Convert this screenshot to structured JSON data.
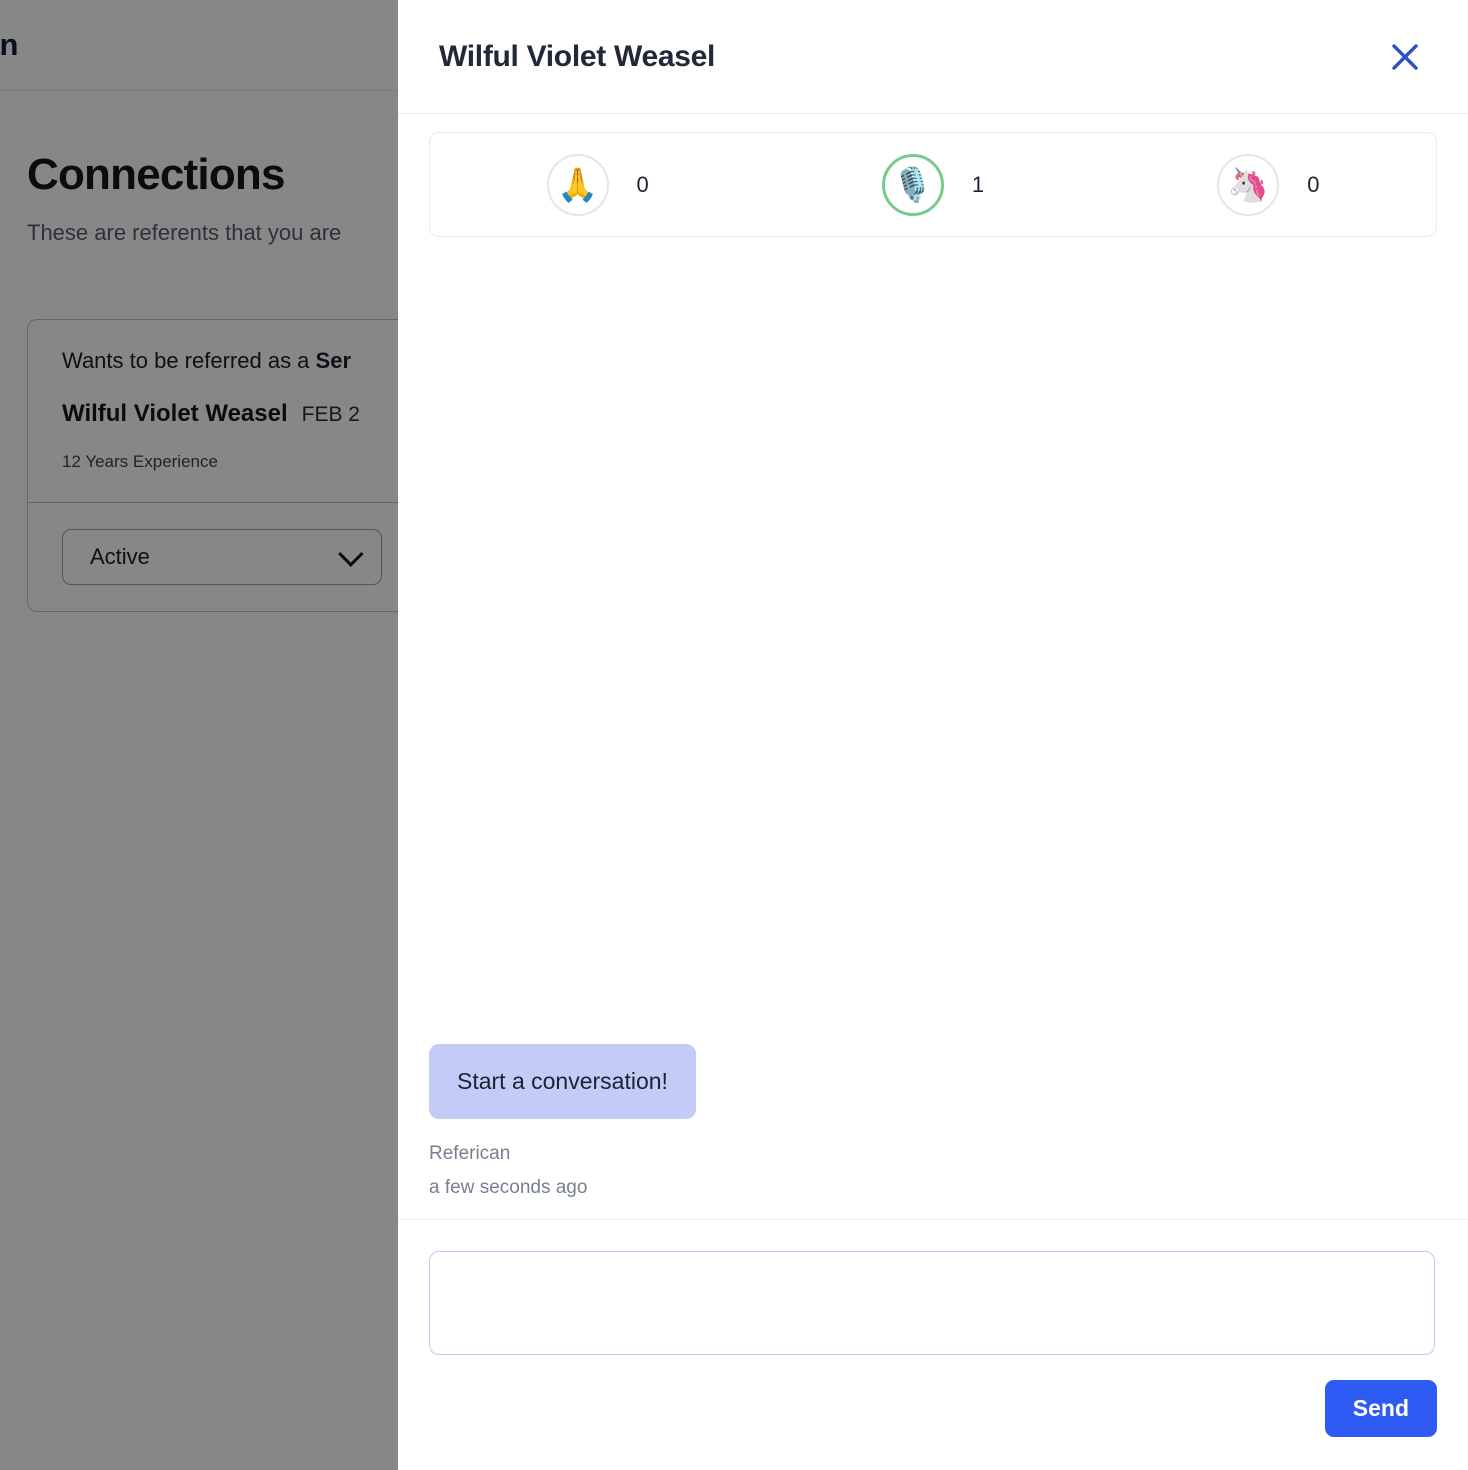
{
  "background_page": {
    "logo_text": "can",
    "title": "Connections",
    "subtitle": "These are referents that you are",
    "card": {
      "referral_prefix": "Wants to be referred as a ",
      "referral_role": "Ser",
      "person_name": "Wilful Violet Weasel",
      "date": "FEB 2",
      "experience": "12 Years Experience",
      "status_value": "Active"
    }
  },
  "drawer": {
    "title": "Wilful Violet Weasel",
    "close_label": "×",
    "reactions": [
      {
        "icon": "🙏",
        "icon_name": "folded-hands-emoji",
        "count": "0",
        "selected": false
      },
      {
        "icon": "🎙️",
        "icon_name": "studio-microphone-emoji",
        "count": "1",
        "selected": true
      },
      {
        "icon": "🦄",
        "icon_name": "unicorn-emoji",
        "count": "0",
        "selected": false
      }
    ],
    "messages": [
      {
        "text": "Start a conversation!",
        "author": "Referican",
        "timestamp": "a few seconds ago"
      }
    ],
    "composer": {
      "value": "",
      "placeholder": "",
      "send_label": "Send"
    }
  },
  "colors": {
    "accent_blue": "#2f5bf5",
    "close_blue": "#2b4fc4",
    "bubble_bg": "#c2ccf7",
    "selected_ring_green": "#79cb8c",
    "input_border": "#bcc8f3"
  }
}
